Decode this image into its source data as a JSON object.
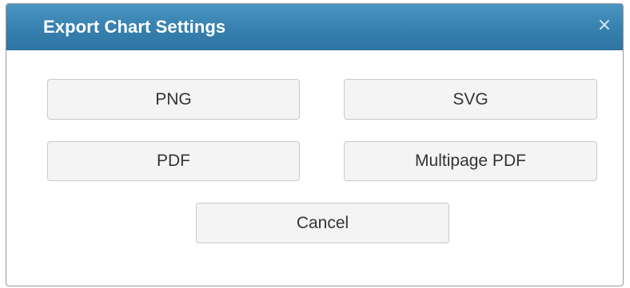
{
  "dialog": {
    "title": "Export Chart Settings",
    "close_glyph": "×",
    "close_icon": "close-icon",
    "buttons": {
      "png": "PNG",
      "svg": "SVG",
      "pdf": "PDF",
      "multipage_pdf": "Multipage PDF",
      "cancel": "Cancel"
    }
  },
  "colors": {
    "titlebar": "#357ead",
    "title_text": "#ffffff",
    "button_bg": "#f4f4f4",
    "button_border": "#c9c9c9"
  }
}
